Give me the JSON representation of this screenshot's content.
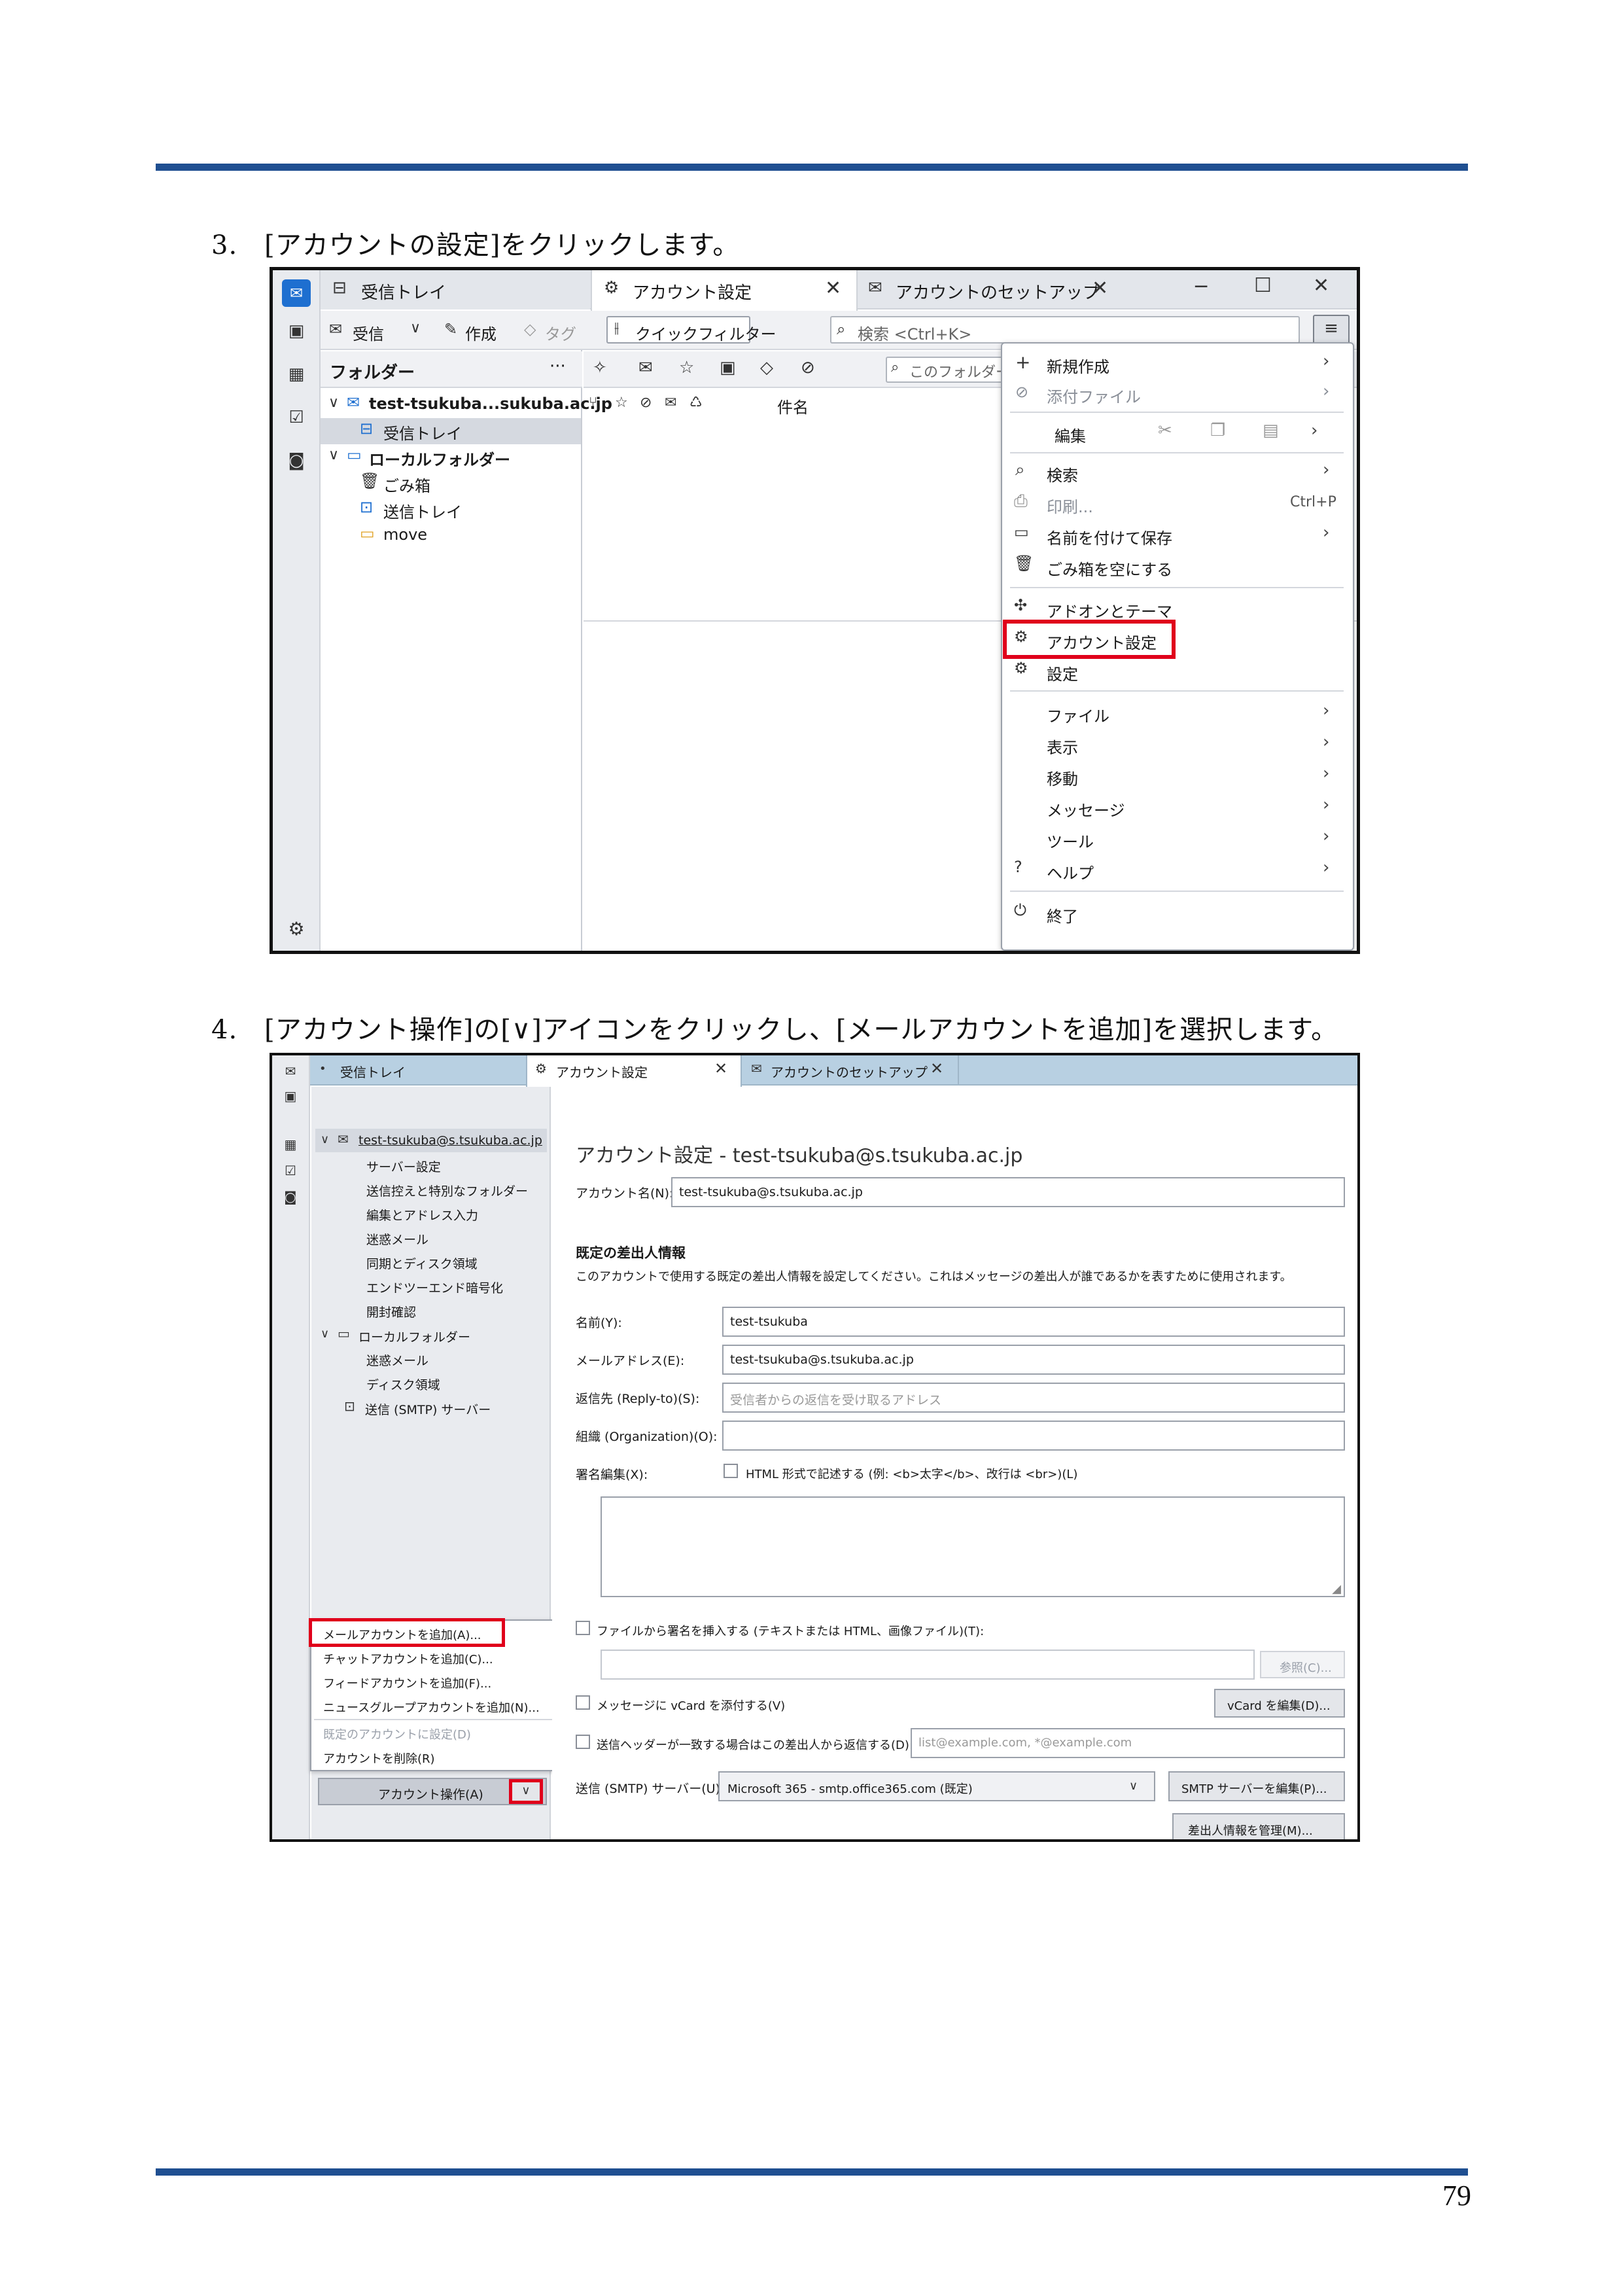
{
  "page": {
    "step3": "3.　[アカウントの設定]をクリックします。",
    "step4": "4.　[アカウント操作]の[∨]アイコンをクリックし、[メールアカウントを追加]を選択します。",
    "page_number": "79",
    "colors": {
      "rule": "#1f4f91",
      "highlight": "#e0001b",
      "accent": "#1e6fd0"
    }
  },
  "shot1": {
    "tabs": [
      {
        "label": "受信トレイ",
        "icon": "inbox-icon"
      },
      {
        "label": "アカウント設定",
        "icon": "account-settings-icon"
      },
      {
        "label": "アカウントのセットアップ",
        "icon": "account-setup-icon"
      }
    ],
    "toolbar": {
      "get_mail": "受信",
      "write": "作成",
      "tag": "タグ",
      "quick_filter": "クイックフィルター",
      "search_placeholder": "検索 <Ctrl+K>"
    },
    "folder_header": {
      "title": "フォルダー",
      "more": "···"
    },
    "folders": [
      {
        "label": "test-tsukuba...sukuba.ac.jp",
        "icon": "mail-account-icon",
        "level": 0
      },
      {
        "label": "受信トレイ",
        "icon": "inbox-icon",
        "level": 1
      },
      {
        "label": "ローカルフォルダー",
        "icon": "folder-icon",
        "level": 0
      },
      {
        "label": "ごみ箱",
        "icon": "trash-icon",
        "level": 1
      },
      {
        "label": "送信トレイ",
        "icon": "outbox-icon",
        "level": 1
      },
      {
        "label": "move",
        "icon": "folder-icon",
        "level": 1
      }
    ],
    "message_list": {
      "filter_placeholder": "このフォルダーの",
      "subject_header": "件名"
    },
    "menu": {
      "new": "新規作成",
      "attach": "添付ファイル",
      "edit": "編集",
      "search": "検索",
      "print": "印刷...",
      "print_shortcut": "Ctrl+P",
      "save_as": "名前を付けて保存",
      "empty_trash": "ごみ箱を空にする",
      "addons": "アドオンとテーマ",
      "account_settings": "アカウント設定",
      "settings": "設定",
      "file": "ファイル",
      "view": "表示",
      "go": "移動",
      "message": "メッセージ",
      "tools": "ツール",
      "help": "ヘルプ",
      "quit": "終了"
    }
  },
  "shot2": {
    "tabs": [
      {
        "label": "受信トレイ",
        "icon": "inbox-icon"
      },
      {
        "label": "アカウント設定",
        "icon": "account-settings-icon"
      },
      {
        "label": "アカウントのセットアップ",
        "icon": "account-setup-icon"
      }
    ],
    "tree": [
      {
        "label": "test-tsukuba@s.tsukuba.ac.jp",
        "level": 0
      },
      {
        "label": "サーバー設定",
        "level": 1
      },
      {
        "label": "送信控えと特別なフォルダー",
        "level": 1
      },
      {
        "label": "編集とアドレス入力",
        "level": 1
      },
      {
        "label": "迷惑メール",
        "level": 1
      },
      {
        "label": "同期とディスク領域",
        "level": 1
      },
      {
        "label": "エンドツーエンド暗号化",
        "level": 1
      },
      {
        "label": "開封確認",
        "level": 1
      },
      {
        "label": "ローカルフォルダー",
        "level": 0
      },
      {
        "label": "迷惑メール",
        "level": 1
      },
      {
        "label": "ディスク領域",
        "level": 1
      },
      {
        "label": "送信 (SMTP) サーバー",
        "level": 0
      }
    ],
    "dropdown": [
      {
        "label": "メールアカウントを追加(A)...",
        "enabled": true
      },
      {
        "label": "チャットアカウントを追加(C)...",
        "enabled": true
      },
      {
        "label": "フィードアカウントを追加(F)...",
        "enabled": true
      },
      {
        "label": "ニュースグループアカウントを追加(N)...",
        "enabled": true
      },
      {
        "label": "既定のアカウントに設定(D)",
        "enabled": false
      },
      {
        "label": "アカウントを削除(R)",
        "enabled": true
      }
    ],
    "account_actions": "アカウント操作(A)",
    "title": "アカウント設定 - test-tsukuba@s.tsukuba.ac.jp",
    "account_name_label": "アカウント名(N):",
    "account_name_value": "test-tsukuba@s.tsukuba.ac.jp",
    "identity_heading": "既定の差出人情報",
    "identity_desc": "このアカウントで使用する既定の差出人情報を設定してください。これはメッセージの差出人が誰であるかを表すために使用されます。",
    "name_label": "名前(Y):",
    "name_value": "test-tsukuba",
    "email_label": "メールアドレス(E):",
    "email_value": "test-tsukuba@s.tsukuba.ac.jp",
    "replyto_label": "返信先 (Reply-to)(S):",
    "replyto_placeholder": "受信者からの返信を受け取るアドレス",
    "org_label": "組織 (Organization)(O):",
    "sig_label": "署名編集(X):",
    "sig_html": "HTML 形式で記述する (例: <b>太字</b>、改行は <br>)(L)",
    "sig_file": "ファイルから署名を挿入する (テキストまたは HTML、画像ファイル)(T):",
    "browse": "参照(C)...",
    "vcard": "メッセージに vCard を添付する(V)",
    "edit_vcard": "vCard を編集(D)...",
    "reply_from": "送信ヘッダーが一致する場合はこの差出人から返信する(D):",
    "reply_from_placeholder": "list@example.com, *@example.com",
    "smtp_label": "送信 (SMTP) サーバー(U):",
    "smtp_value": "Microsoft 365 - smtp.office365.com (既定)",
    "edit_smtp": "SMTP サーバーを編集(P)...",
    "manage_ids": "差出人情報を管理(M)..."
  }
}
